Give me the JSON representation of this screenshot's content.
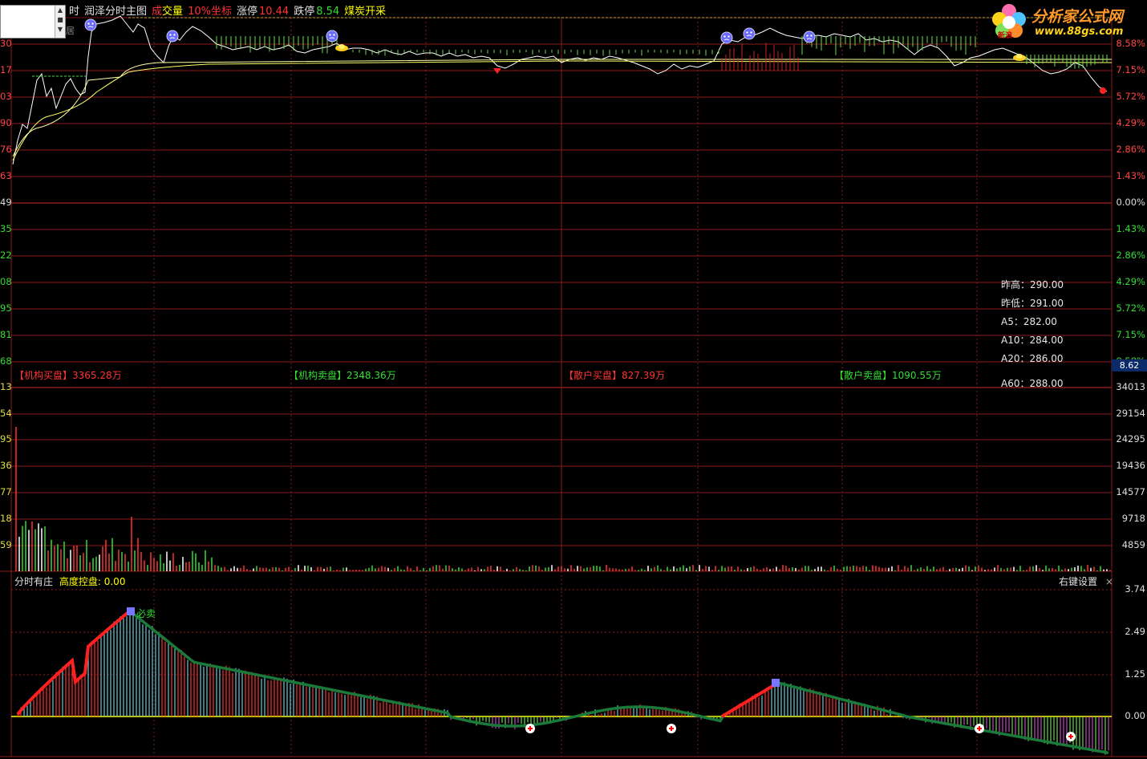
{
  "header": {
    "prefix": "时",
    "indicator_name": "润泽分时主图",
    "volume_label_a": "成",
    "volume_label_b": "交量",
    "coord_label": "10%坐标",
    "limit_up_label": "涨停",
    "limit_up_value": "10.44",
    "limit_down_label": "跌停",
    "limit_down_value": "8.54",
    "sector": "煤炭开采"
  },
  "left_ctrl_text": "居",
  "logo": {
    "name": "分析家公式网",
    "url": "www.88gs.com",
    "badge": "新浪"
  },
  "price_axis": {
    "left": [
      "30",
      "17",
      "03",
      "90",
      "76",
      "63",
      "49",
      "35",
      "22",
      "08",
      "95",
      "81",
      "68"
    ],
    "right": [
      "8.58%",
      "7.15%",
      "5.72%",
      "4.29%",
      "2.86%",
      "1.43%",
      "0.00%",
      "1.43%",
      "2.86%",
      "4.29%",
      "5.72%",
      "7.15%",
      "8.58%"
    ]
  },
  "current_price": "8.62",
  "info_panel": [
    {
      "label": "昨高",
      "value": "290.00"
    },
    {
      "label": "昨低",
      "value": "291.00"
    },
    {
      "label": "A5",
      "value": "282.00"
    },
    {
      "label": "A10",
      "value": "284.00"
    },
    {
      "label": "A20",
      "value": "286.00"
    },
    {
      "label": "A60",
      "value": "288.00"
    }
  ],
  "flow_stats": [
    {
      "label": "【机构买盘】",
      "value": "3365.28万",
      "color": "#ff3333"
    },
    {
      "label": "【机构卖盘】",
      "value": "2348.36万",
      "color": "#33dd33"
    },
    {
      "label": "【散户买盘】",
      "value": "827.39万",
      "color": "#ff3333"
    },
    {
      "label": "【散户卖盘】",
      "value": "1090.55万",
      "color": "#33dd33"
    }
  ],
  "volume_axis": {
    "left": [
      "13",
      "54",
      "95",
      "36",
      "77",
      "18",
      "59"
    ],
    "right": [
      "34013",
      "29154",
      "24295",
      "19436",
      "14577",
      "9718",
      "4859"
    ]
  },
  "indicator": {
    "title": "分时有庄",
    "sub_label": "高度控盘",
    "sub_value": "0.00",
    "settings": "右键设置",
    "close": "×",
    "sell_signal": "必卖",
    "axis": [
      "3.74",
      "2.49",
      "1.25",
      "0.00"
    ]
  },
  "colors": {
    "grid": "#8a1a1a",
    "price_line": "#ffffff",
    "avg_line": "#ffff66",
    "up": "#ff2020",
    "down": "#20c020",
    "zero_line": "#ffff00"
  }
}
